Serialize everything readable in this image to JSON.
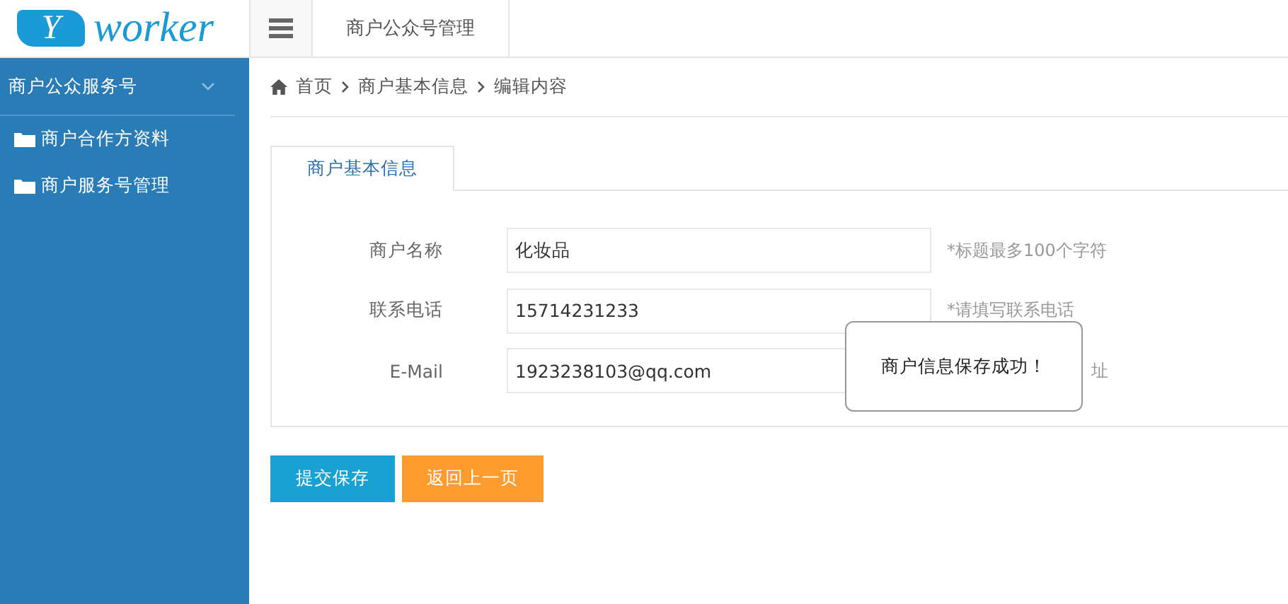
{
  "logo": {
    "mark": "Y",
    "name": "worker"
  },
  "header": {
    "title": "商户公众号管理"
  },
  "sidebar": {
    "group": {
      "label": "商户公众服务号",
      "expanded": true
    },
    "items": [
      {
        "label": "商户合作方资料"
      },
      {
        "label": "商户服务号管理"
      }
    ]
  },
  "breadcrumb": [
    "首页",
    "商户基本信息",
    "编辑内容"
  ],
  "tabs": [
    {
      "label": "商户基本信息",
      "selected": true
    }
  ],
  "form": [
    {
      "label": "商户名称",
      "value": "化妆品",
      "hint": "*标题最多100个字符",
      "hint_covered": false
    },
    {
      "label": "联系电话",
      "value": "15714231233",
      "hint": "*请填写联系电话",
      "hint_covered": false
    },
    {
      "label": "E-Mail",
      "value": "1923238103@qq.com",
      "hint": "址",
      "hint_covered": true
    }
  ],
  "buttons": [
    {
      "label": "提交保存",
      "kind": "primary"
    },
    {
      "label": "返回上一页",
      "kind": "secondary"
    }
  ],
  "toast": {
    "message": "商户信息保存成功！"
  }
}
